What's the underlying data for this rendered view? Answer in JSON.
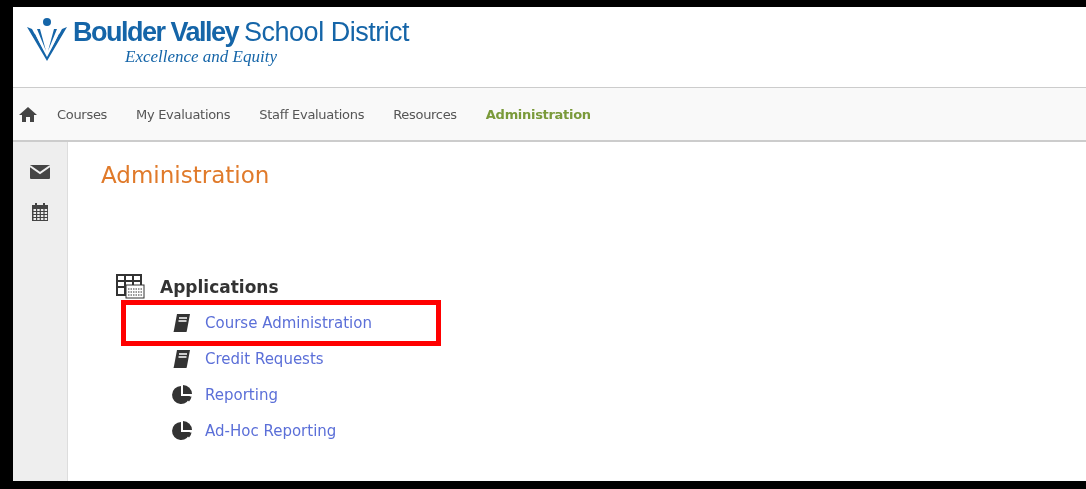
{
  "logo": {
    "name_bold": "Boulder Valley",
    "name_light": "School District",
    "tagline": "Excellence and Equity"
  },
  "nav": [
    {
      "label": "Courses",
      "selected": false
    },
    {
      "label": "My Evaluations",
      "selected": false
    },
    {
      "label": "Staff Evaluations",
      "selected": false
    },
    {
      "label": "Resources",
      "selected": false
    },
    {
      "label": "Administration",
      "selected": true
    }
  ],
  "page_title": "Administration",
  "section": {
    "title": "Applications",
    "items": [
      {
        "label": "Course Administration",
        "kind": "book",
        "highlighted": true
      },
      {
        "label": "Credit Requests",
        "kind": "book",
        "highlighted": false
      },
      {
        "label": "Reporting",
        "kind": "pie",
        "highlighted": false
      },
      {
        "label": "Ad-Hoc Reporting",
        "kind": "pie",
        "highlighted": false
      }
    ]
  }
}
